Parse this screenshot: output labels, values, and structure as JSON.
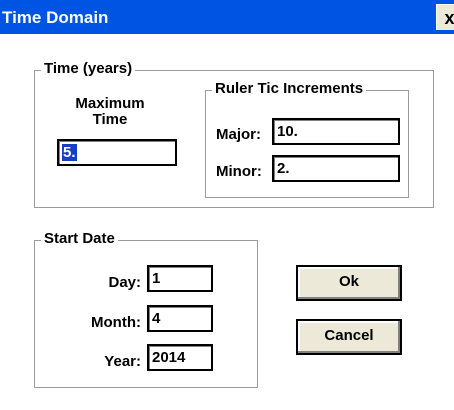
{
  "window": {
    "title": "Time Domain",
    "close_glyph": "x"
  },
  "time_years": {
    "legend": "Time (years)",
    "max_label_line1": "Maximum",
    "max_label_line2": "Time",
    "max_value": "5.",
    "ruler": {
      "legend": "Ruler Tic Increments",
      "major_label": "Major:",
      "major_value": "10.",
      "minor_label": "Minor:",
      "minor_value": "2."
    }
  },
  "start_date": {
    "legend": "Start Date",
    "day_label": "Day:",
    "day_value": "1",
    "month_label": "Month:",
    "month_value": "4",
    "year_label": "Year:",
    "year_value": "2014"
  },
  "buttons": {
    "ok": "Ok",
    "cancel": "Cancel"
  },
  "colors": {
    "titlebar": "#0054e3",
    "button_face": "#ece9d8",
    "selection": "#1a3cc8"
  }
}
